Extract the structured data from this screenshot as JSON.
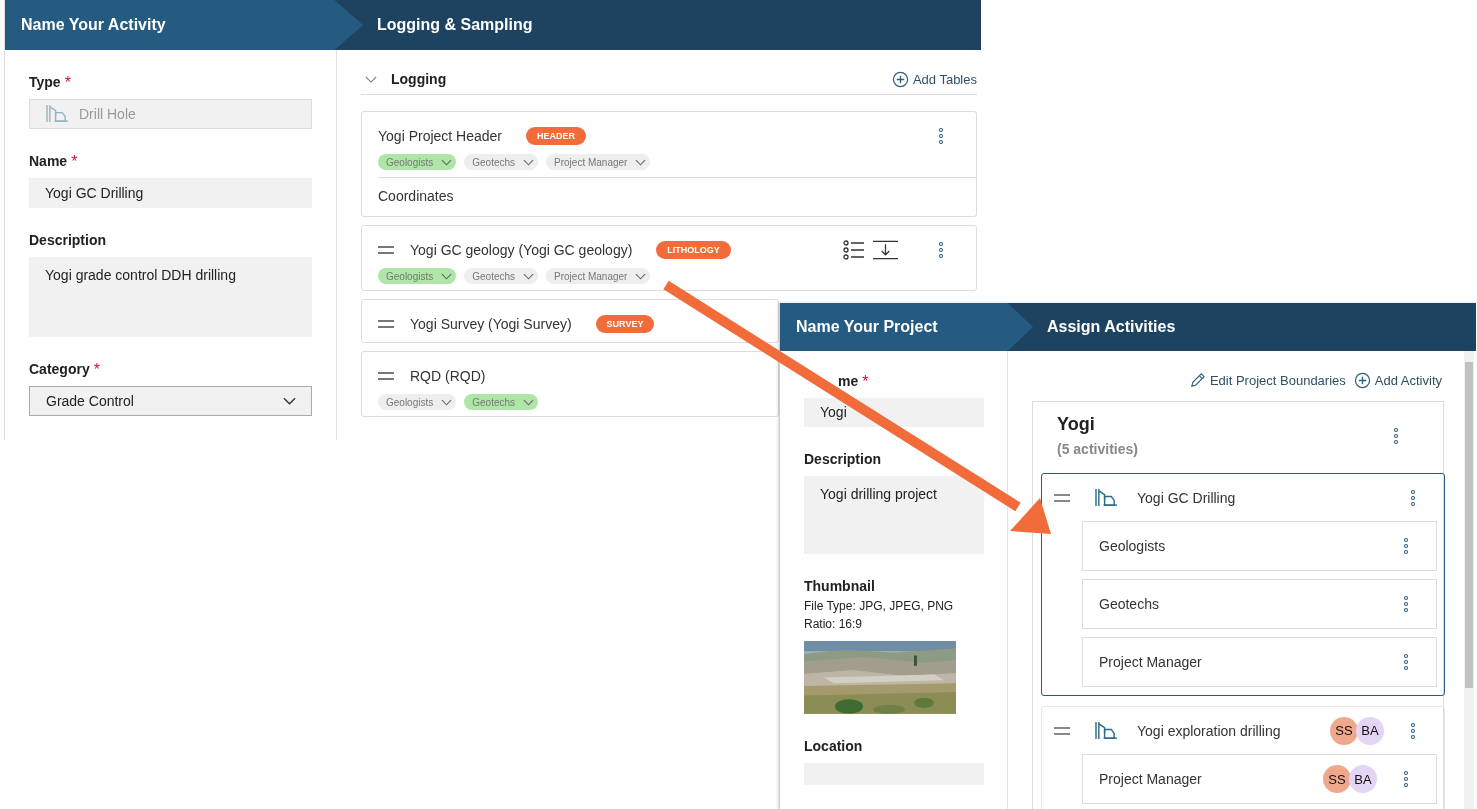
{
  "activity_window": {
    "steps": [
      "Name Your Activity",
      "Logging & Sampling"
    ],
    "fields": [
      {
        "kind": "type",
        "label": "Type",
        "required_mark": "*",
        "value": "Drill Hole",
        "disabled": true
      },
      {
        "kind": "input",
        "label": "Name",
        "required_mark": "*",
        "value": "Yogi GC Drilling"
      },
      {
        "kind": "textarea",
        "label": "Description",
        "value": "Yogi grade control DDH drilling"
      },
      {
        "kind": "select",
        "label": "Category",
        "required_mark": "*",
        "value": "Grade Control"
      }
    ],
    "section": {
      "title": "Logging",
      "expanded": true,
      "action": "Add Tables",
      "tables": [
        {
          "title": "Yogi Project Header",
          "draggable": false,
          "badge": "HEADER",
          "tools": false,
          "menu": true,
          "roles": [
            {
              "label": "Geologists",
              "assigned": true
            },
            {
              "label": "Geotechs",
              "assigned": false
            },
            {
              "label": "Project Manager",
              "assigned": false
            }
          ],
          "columns": [
            "Coordinates"
          ]
        },
        {
          "title": "Yogi GC geology (Yogi GC geology)",
          "draggable": true,
          "badge": "LITHOLOGY",
          "tools": true,
          "menu": true,
          "roles": [
            {
              "label": "Geologists",
              "assigned": true
            },
            {
              "label": "Geotechs",
              "assigned": false
            },
            {
              "label": "Project Manager",
              "assigned": false
            }
          ]
        },
        {
          "title": "Yogi Survey (Yogi Survey)",
          "draggable": true,
          "badge": "SURVEY",
          "tools": false,
          "menu": false
        },
        {
          "title": "RQD (RQD)",
          "draggable": true,
          "tools": false,
          "menu": false,
          "roles": [
            {
              "label": "Geologists",
              "assigned": false
            },
            {
              "label": "Geotechs",
              "assigned": true
            }
          ]
        }
      ]
    }
  },
  "project_window": {
    "steps": [
      "Name Your Project",
      "Assign Activities"
    ],
    "fields": [
      {
        "kind": "input",
        "label": "me",
        "required_mark": "*",
        "value": "Yogi"
      },
      {
        "kind": "textarea",
        "label": "Description",
        "value": "Yogi drilling project"
      }
    ],
    "thumbnail": {
      "label": "Thumbnail",
      "file_type": "File Type: JPG, JPEG, PNG",
      "ratio": "Ratio: 16:9"
    },
    "location": {
      "label": "Location"
    },
    "actions": [
      {
        "kind": "edit",
        "label": "Edit Project Boundaries"
      },
      {
        "kind": "add",
        "label": "Add Activity"
      }
    ],
    "project": {
      "name": "Yogi",
      "count": "(5 activities)",
      "activities": [
        {
          "name": "Yogi GC Drilling",
          "selected": true,
          "roles": [
            {
              "name": "Geologists"
            },
            {
              "name": "Geotechs"
            },
            {
              "name": "Project Manager"
            }
          ]
        },
        {
          "name": "Yogi exploration drilling",
          "selected": false,
          "avatars": [
            {
              "initials": "SS",
              "color": "#f0a88c"
            },
            {
              "initials": "BA",
              "color": "#e3d5f3"
            }
          ],
          "roles": [
            {
              "name": "Project Manager",
              "avatars": [
                {
                  "initials": "SS",
                  "color": "#f0a88c"
                },
                {
                  "initials": "BA",
                  "color": "#e3d5f3"
                }
              ]
            }
          ]
        }
      ]
    }
  }
}
